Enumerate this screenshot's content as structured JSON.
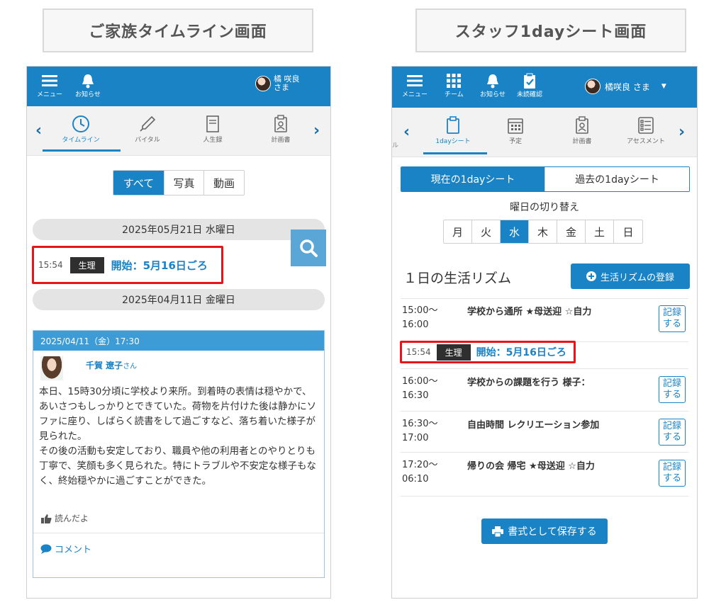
{
  "left_label": "ご家族タイムライン画面",
  "right_label": "スタッフ1dayシート画面",
  "left": {
    "topbar": {
      "menu": "メニュー",
      "notice": "お知らせ",
      "user_name": "橘 咲良",
      "user_suffix": "さま"
    },
    "tabs": [
      {
        "label": "タイムライン",
        "icon": "clock-icon"
      },
      {
        "label": "バイタル",
        "icon": "thermometer-icon"
      },
      {
        "label": "人生録",
        "icon": "book-icon"
      },
      {
        "label": "計画書",
        "icon": "clipboard-icon"
      }
    ],
    "filters": [
      "すべて",
      "写真",
      "動画"
    ],
    "date1": "2025年05月21日 水曜日",
    "entry": {
      "time": "15:54",
      "tag": "生理",
      "text": "開始：5月16日ごろ"
    },
    "date2": "2025年04月11日 金曜日",
    "card": {
      "header": "2025/04/11（金）17:30",
      "author": "千賀 遼子",
      "author_suffix": "さん",
      "body": "本日、15時30分頃に学校より来所。到着時の表情は穏やかで、あいさつもしっかりとできていた。荷物を片付けた後は静かにソファに座り、しばらく読書をして過ごすなど、落ち着いた様子が見られた。\nその後の活動も安定しており、職員や他の利用者とのやりとりも丁寧で、笑顔も多く見られた。特にトラブルや不安定な様子もなく、終始穏やかに過ごすことができた。",
      "like": "読んだよ",
      "comment": "コメント"
    }
  },
  "right": {
    "topbar": {
      "menu": "メニュー",
      "team": "チーム",
      "notice": "お知らせ",
      "unconfirmed": "未読確認",
      "user": "橘咲良 さま"
    },
    "tabs": [
      {
        "label": "1dayシート",
        "icon": "clipboard-icon"
      },
      {
        "label": "予定",
        "icon": "calendar-icon"
      },
      {
        "label": "計画書",
        "icon": "badge-icon"
      },
      {
        "label": "アセスメント",
        "icon": "checklist-icon"
      }
    ],
    "partial_left_tab": "ル",
    "sheet_tabs": [
      "現在の1dayシート",
      "過去の1dayシート"
    ],
    "weekday_title": "曜日の切り替え",
    "weekdays": [
      "月",
      "火",
      "水",
      "木",
      "金",
      "土",
      "日"
    ],
    "rhythm_title": "１日の生活リズム",
    "register_btn": "生活リズムの登録",
    "rows": [
      {
        "time": "15:00〜\n16:00",
        "title": "学校から通所 ★母送迎 ☆自力",
        "btn": "記録\nする"
      },
      {
        "time": "16:00〜\n16:30",
        "title": "学校からの課題を行う 様子：",
        "btn": "記録\nする"
      },
      {
        "time": "16:30〜\n17:00",
        "title": "自由時間 レクリエーション参加",
        "btn": "記録\nする"
      },
      {
        "time": "17:20〜\n06:10",
        "title": "帰りの会 帰宅 ★母送迎 ☆自力",
        "btn": "記録\nする"
      }
    ],
    "entry": {
      "time": "15:54",
      "tag": "生理",
      "text": "開始：5月16日ごろ"
    },
    "save_btn": "書式として保存する"
  },
  "colors": {
    "primary": "#1a83c6",
    "highlight": "#e8141a"
  }
}
